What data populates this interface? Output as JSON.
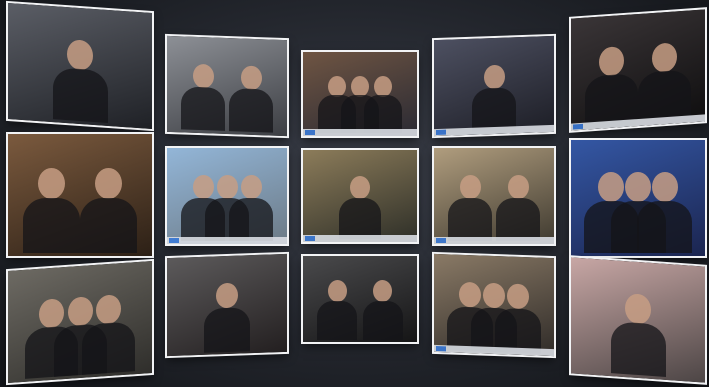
{
  "wall": {
    "columns": [
      {
        "tiles": [
          {
            "id": "tile-r1c1",
            "theme": [
              "#5b5e66",
              "#1f2126"
            ],
            "bar": false
          },
          {
            "id": "tile-r2c1",
            "theme": [
              "#7b5a3e",
              "#2c2016"
            ],
            "bar": false
          },
          {
            "id": "tile-r3c1",
            "theme": [
              "#6d6a63",
              "#2f2e2b"
            ],
            "bar": false
          }
        ]
      },
      {
        "tiles": [
          {
            "id": "tile-r1c2",
            "theme": [
              "#8d9096",
              "#3c3e43"
            ],
            "bar": false
          },
          {
            "id": "tile-r2c2",
            "theme": [
              "#93b6d8",
              "#6c7a86"
            ],
            "bar": true
          },
          {
            "id": "tile-r3c2",
            "theme": [
              "#5c5a5b",
              "#231f20"
            ],
            "bar": false
          }
        ]
      },
      {
        "tiles": [
          {
            "id": "tile-r1c3",
            "theme": [
              "#6f5543",
              "#2a2a33"
            ],
            "bar": true
          },
          {
            "id": "tile-r2c3",
            "theme": [
              "#8c7c5a",
              "#2e2f28"
            ],
            "bar": true
          },
          {
            "id": "tile-r3c3",
            "theme": [
              "#4a4a4c",
              "#151516"
            ],
            "bar": false
          }
        ]
      },
      {
        "tiles": [
          {
            "id": "tile-r1c4",
            "theme": [
              "#4d5061",
              "#1d1e26"
            ],
            "bar": true
          },
          {
            "id": "tile-r2c4",
            "theme": [
              "#b09d7e",
              "#3f3a30"
            ],
            "bar": true
          },
          {
            "id": "tile-r3c4",
            "theme": [
              "#8a7a66",
              "#2f2b28"
            ],
            "bar": true
          }
        ]
      },
      {
        "tiles": [
          {
            "id": "tile-r1c5",
            "theme": [
              "#3a3537",
              "#0f0e0f"
            ],
            "bar": true
          },
          {
            "id": "tile-r2c5",
            "theme": [
              "#3457a4",
              "#1b2550"
            ],
            "bar": false
          },
          {
            "id": "tile-r3c5",
            "theme": [
              "#c8a7a5",
              "#4c4545"
            ],
            "bar": false
          }
        ]
      }
    ]
  }
}
